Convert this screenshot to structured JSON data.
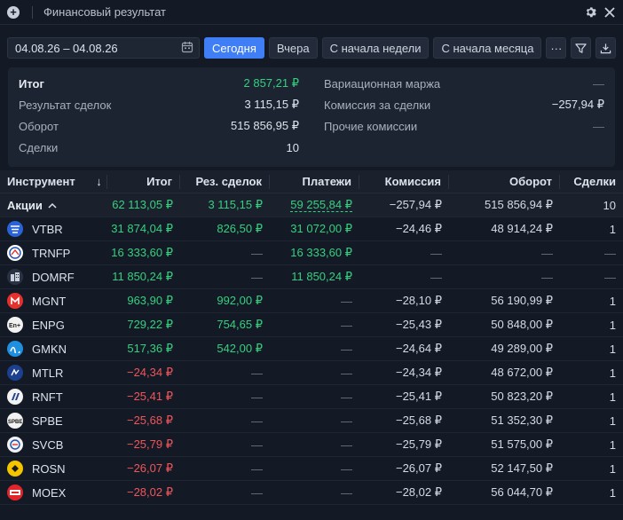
{
  "window": {
    "title": "Финансовый результат"
  },
  "toolbar": {
    "date_range": "04.08.26 – 04.08.26",
    "buttons": {
      "today": "Сегодня",
      "yesterday": "Вчера",
      "week": "С начала недели",
      "month": "С начала месяца",
      "more": "···"
    }
  },
  "summary": {
    "left": [
      {
        "label": "Итог",
        "value": "2 857,21 ₽"
      },
      {
        "label": "Результат сделок",
        "value": "3 115,15 ₽"
      },
      {
        "label": "Оборот",
        "value": "515 856,95 ₽"
      },
      {
        "label": "Сделки",
        "value": "10"
      }
    ],
    "right": [
      {
        "label": "Вариационная маржа",
        "value": "—"
      },
      {
        "label": "Комиссия за сделки",
        "value": "−257,94 ₽"
      },
      {
        "label": "Прочие комиссии",
        "value": "—"
      }
    ]
  },
  "table": {
    "headers": {
      "instrument": "Инструмент",
      "sort": "↓",
      "itog": "Итог",
      "rez": "Рез. сделок",
      "pay": "Платежи",
      "com": "Комиссия",
      "turn": "Оборот",
      "deals": "Сделки"
    },
    "group": {
      "name": "Акции",
      "chevron": "^",
      "itog": "62 113,05 ₽",
      "rez": "3 115,15 ₽",
      "pay": "59 255,84 ₽",
      "com": "−257,94 ₽",
      "turn": "515 856,94 ₽",
      "deals": "10"
    },
    "rows": [
      {
        "ticker": "VTBR",
        "logo": "vtb-logo",
        "logo_color": "#2a62d8",
        "itog": "31 874,04 ₽",
        "rez": "826,50 ₽",
        "pay": "31 072,00 ₽",
        "com": "−24,46 ₽",
        "turn": "48 914,24 ₽",
        "deals": "1"
      },
      {
        "ticker": "TRNFP",
        "logo": "transneft-logo",
        "logo_color": "#ffffff",
        "itog": "16 333,60 ₽",
        "rez": "—",
        "pay": "16 333,60 ₽",
        "com": "—",
        "turn": "—",
        "deals": "—"
      },
      {
        "ticker": "DOMRF",
        "logo": "domrf-logo",
        "logo_color": "#2a3344",
        "itog": "11 850,24 ₽",
        "rez": "—",
        "pay": "11 850,24 ₽",
        "com": "—",
        "turn": "—",
        "deals": "—"
      },
      {
        "ticker": "MGNT",
        "logo": "magnit-logo",
        "logo_color": "#e5312e",
        "itog": "963,90 ₽",
        "rez": "992,00 ₽",
        "pay": "—",
        "com": "−28,10 ₽",
        "turn": "56 190,99 ₽",
        "deals": "1"
      },
      {
        "ticker": "ENPG",
        "logo": "enplus-logo",
        "logo_color": "#f2f2f2",
        "itog": "729,22 ₽",
        "rez": "754,65 ₽",
        "pay": "—",
        "com": "−25,43 ₽",
        "turn": "50 848,00 ₽",
        "deals": "1"
      },
      {
        "ticker": "GMKN",
        "logo": "nornickel-logo",
        "logo_color": "#1f8fe0",
        "itog": "517,36 ₽",
        "rez": "542,00 ₽",
        "pay": "—",
        "com": "−24,64 ₽",
        "turn": "49 289,00 ₽",
        "deals": "1"
      },
      {
        "ticker": "MTLR",
        "logo": "mechel-logo",
        "logo_color": "#1c3f8f",
        "itog": "−24,34 ₽",
        "rez": "—",
        "pay": "—",
        "com": "−24,34 ₽",
        "turn": "48 672,00 ₽",
        "deals": "1"
      },
      {
        "ticker": "RNFT",
        "logo": "russneft-logo",
        "logo_color": "#f2f2f2",
        "itog": "−25,41 ₽",
        "rez": "—",
        "pay": "—",
        "com": "−25,41 ₽",
        "turn": "50 823,20 ₽",
        "deals": "1"
      },
      {
        "ticker": "SPBE",
        "logo": "spbe-logo",
        "logo_color": "#f2f2f2",
        "itog": "−25,68 ₽",
        "rez": "—",
        "pay": "—",
        "com": "−25,68 ₽",
        "turn": "51 352,30 ₽",
        "deals": "1"
      },
      {
        "ticker": "SVCB",
        "logo": "sovcombank-logo",
        "logo_color": "#f2f2f2",
        "itog": "−25,79 ₽",
        "rez": "—",
        "pay": "—",
        "com": "−25,79 ₽",
        "turn": "51 575,00 ₽",
        "deals": "1"
      },
      {
        "ticker": "ROSN",
        "logo": "rosneft-logo",
        "logo_color": "#f5c400",
        "itog": "−26,07 ₽",
        "rez": "—",
        "pay": "—",
        "com": "−26,07 ₽",
        "turn": "52 147,50 ₽",
        "deals": "1"
      },
      {
        "ticker": "MOEX",
        "logo": "moex-logo",
        "logo_color": "#e2252b",
        "itog": "−28,02 ₽",
        "rez": "—",
        "pay": "—",
        "com": "−28,02 ₽",
        "turn": "56 044,70 ₽",
        "deals": "1"
      }
    ]
  }
}
